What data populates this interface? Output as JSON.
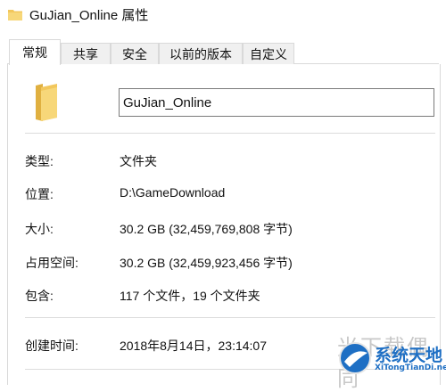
{
  "window": {
    "title": "GuJian_Online 属性"
  },
  "tabs": [
    {
      "label": "常规",
      "active": true
    },
    {
      "label": "共享",
      "active": false
    },
    {
      "label": "安全",
      "active": false
    },
    {
      "label": "以前的版本",
      "active": false
    },
    {
      "label": "自定义",
      "active": false
    }
  ],
  "general": {
    "name": "GuJian_Online",
    "rows": {
      "type": {
        "label": "类型:",
        "value": "文件夹"
      },
      "location": {
        "label": "位置:",
        "value": "D:\\GameDownload"
      },
      "size": {
        "label": "大小:",
        "value": "30.2 GB (32,459,769,808 字节)"
      },
      "size_on_disk": {
        "label": "占用空间:",
        "value": "30.2 GB (32,459,923,456 字节)"
      },
      "contains": {
        "label": "包含:",
        "value": "117 个文件，19 个文件夹"
      },
      "created": {
        "label": "创建时间:",
        "value": "2018年8月14日，23:14:07"
      }
    }
  },
  "watermark": {
    "partial_text": "光下载偶同",
    "brand": "系统天地",
    "url": "XiTongTianDi.net",
    "colors": {
      "brand": "#1e6fc4",
      "ghost": "#c8c8c8"
    }
  },
  "icons": {
    "title": "folder-icon",
    "main": "folder-icon"
  },
  "colors": {
    "folder": "#f2c75c",
    "folder_dark": "#e0b040",
    "border": "#d9d9d9"
  }
}
